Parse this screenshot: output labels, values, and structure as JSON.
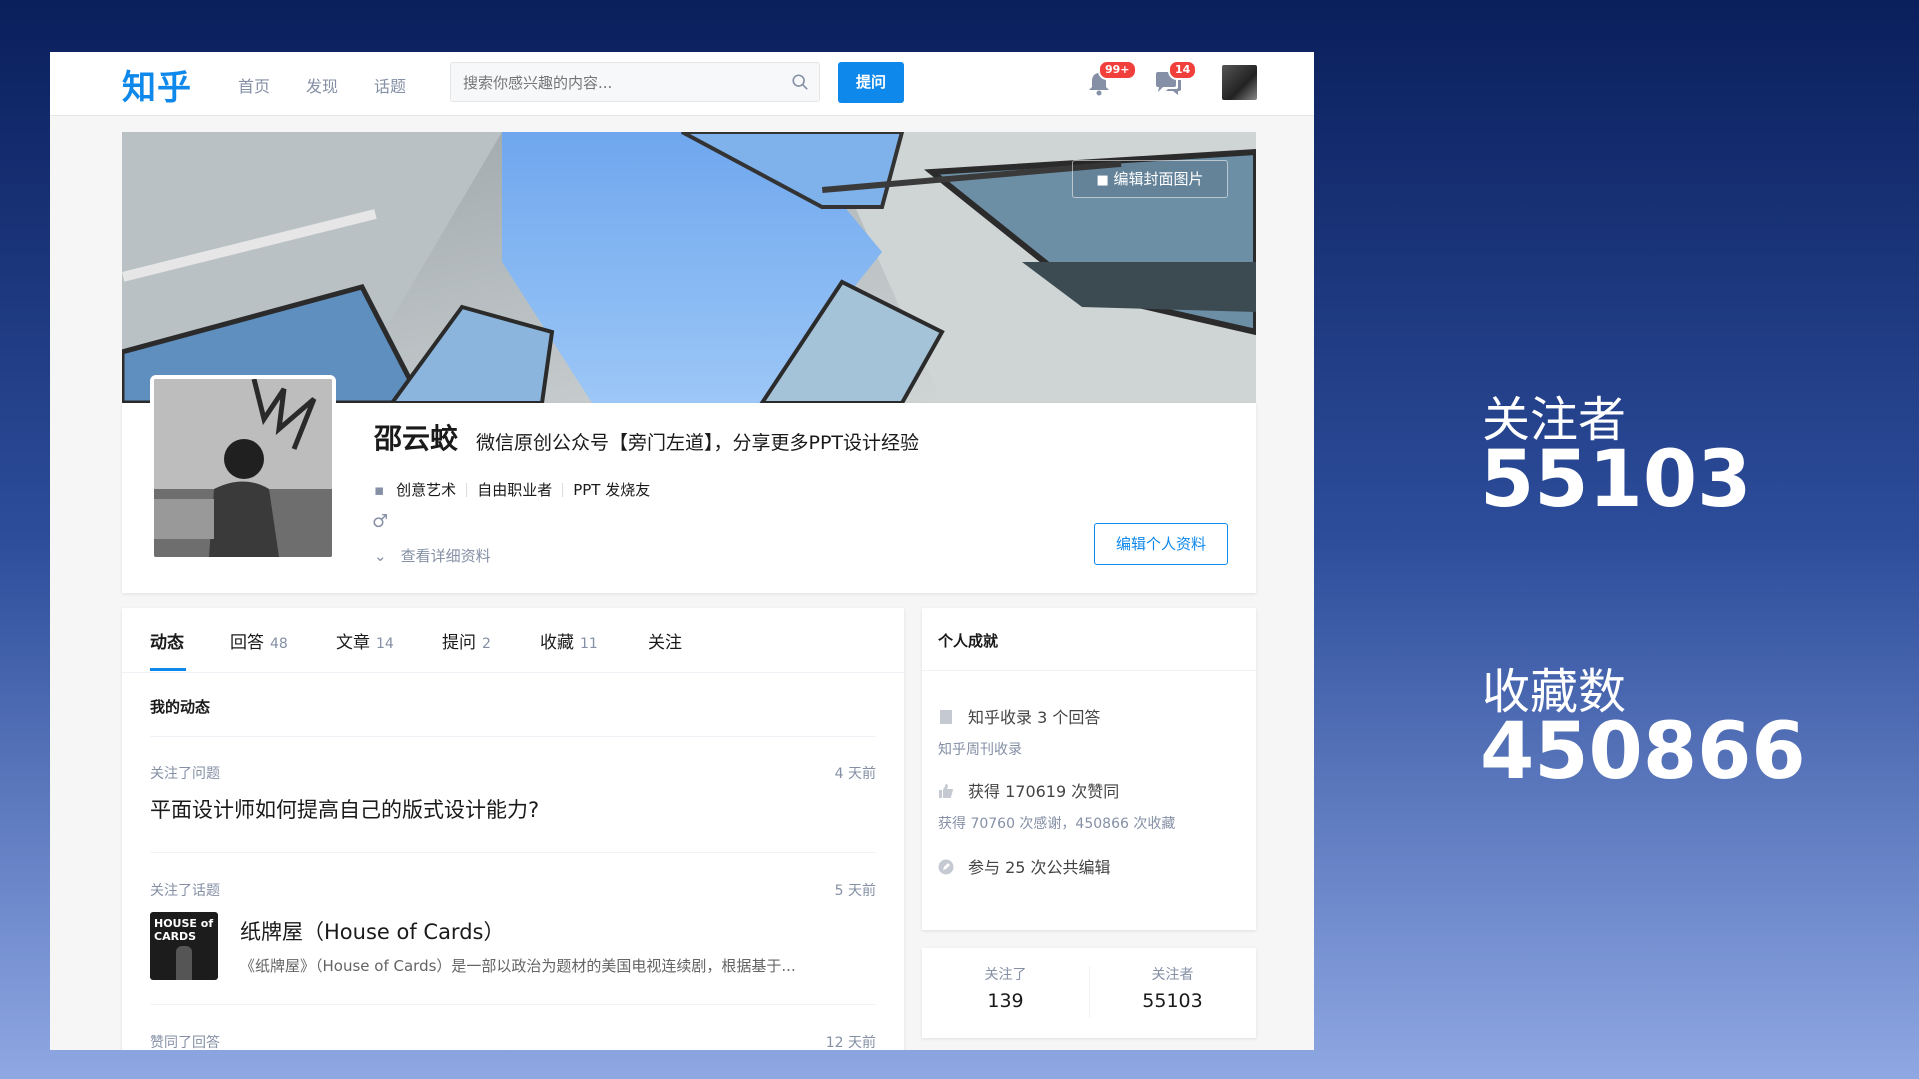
{
  "nav": {
    "logo": "知乎",
    "items": [
      "首页",
      "发现",
      "话题"
    ],
    "search_placeholder": "搜索你感兴趣的内容...",
    "ask_label": "提问",
    "notif_badge": "99+",
    "msg_badge": "14"
  },
  "cover": {
    "edit_label": "编辑封面图片"
  },
  "profile": {
    "name": "邵云蛟",
    "headline": "微信原创公众号【旁门左道】，分享更多PPT设计经验",
    "industry": "创意艺术",
    "job": "自由职业者",
    "title": "PPT 发烧友",
    "gender_symbol": "♂",
    "more_label": "查看详细资料",
    "edit_label": "编辑个人资料"
  },
  "tabs": [
    {
      "label": "动态",
      "count": ""
    },
    {
      "label": "回答",
      "count": "48"
    },
    {
      "label": "文章",
      "count": "14"
    },
    {
      "label": "提问",
      "count": "2"
    },
    {
      "label": "收藏",
      "count": "11"
    },
    {
      "label": "关注",
      "count": ""
    }
  ],
  "feed": {
    "section_title": "我的动态",
    "items": [
      {
        "meta": "关注了问题",
        "time": "4 天前",
        "title": "平面设计师如何提高自己的版式设计能力?"
      },
      {
        "meta": "关注了话题",
        "time": "5 天前",
        "title": "纸牌屋（House of Cards）",
        "desc": "《纸牌屋》（House of Cards）是一部以政治为题材的美国电视连续剧，根据基于...",
        "img_text": "HOUSE of CARDS"
      },
      {
        "meta": "赞同了回答",
        "time": "12 天前"
      }
    ]
  },
  "achievements": {
    "title": "个人成就",
    "rows": [
      {
        "main": "知乎收录 3 个回答",
        "sub": "知乎周刊收录"
      },
      {
        "main": "获得 170619 次赞同",
        "sub": "获得 70760 次感谢，450866 次收藏"
      },
      {
        "main": "参与 25 次公共编辑"
      }
    ]
  },
  "follow": {
    "following_label": "关注了",
    "following_count": "139",
    "followers_label": "关注者",
    "followers_count": "55103"
  },
  "stats": [
    {
      "label": "关注者",
      "value": "55103"
    },
    {
      "label": "收藏数",
      "value": "450866"
    }
  ]
}
